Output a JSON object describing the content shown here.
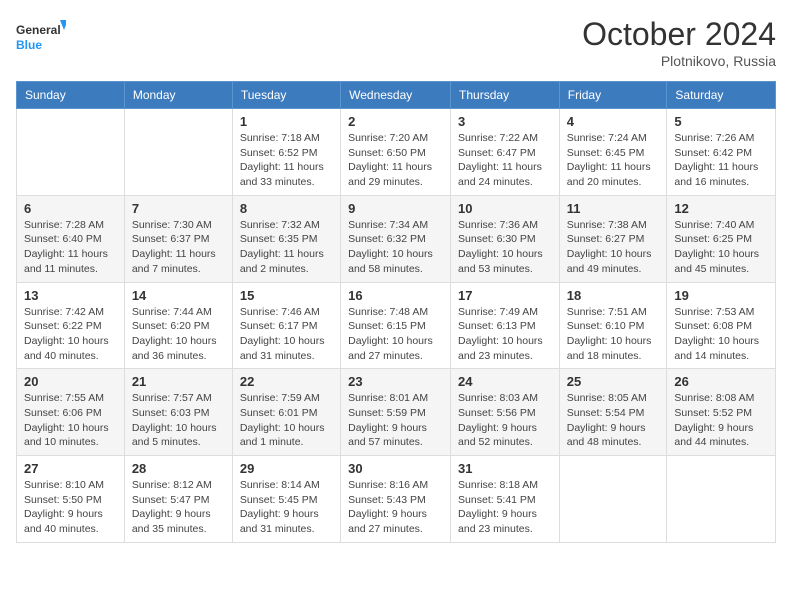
{
  "logo": {
    "general": "General",
    "blue": "Blue"
  },
  "header": {
    "month": "October 2024",
    "location": "Plotnikovo, Russia"
  },
  "weekdays": [
    "Sunday",
    "Monday",
    "Tuesday",
    "Wednesday",
    "Thursday",
    "Friday",
    "Saturday"
  ],
  "weeks": [
    [
      {
        "day": "",
        "info": ""
      },
      {
        "day": "",
        "info": ""
      },
      {
        "day": "1",
        "info": "Sunrise: 7:18 AM\nSunset: 6:52 PM\nDaylight: 11 hours\nand 33 minutes."
      },
      {
        "day": "2",
        "info": "Sunrise: 7:20 AM\nSunset: 6:50 PM\nDaylight: 11 hours\nand 29 minutes."
      },
      {
        "day": "3",
        "info": "Sunrise: 7:22 AM\nSunset: 6:47 PM\nDaylight: 11 hours\nand 24 minutes."
      },
      {
        "day": "4",
        "info": "Sunrise: 7:24 AM\nSunset: 6:45 PM\nDaylight: 11 hours\nand 20 minutes."
      },
      {
        "day": "5",
        "info": "Sunrise: 7:26 AM\nSunset: 6:42 PM\nDaylight: 11 hours\nand 16 minutes."
      }
    ],
    [
      {
        "day": "6",
        "info": "Sunrise: 7:28 AM\nSunset: 6:40 PM\nDaylight: 11 hours\nand 11 minutes."
      },
      {
        "day": "7",
        "info": "Sunrise: 7:30 AM\nSunset: 6:37 PM\nDaylight: 11 hours\nand 7 minutes."
      },
      {
        "day": "8",
        "info": "Sunrise: 7:32 AM\nSunset: 6:35 PM\nDaylight: 11 hours\nand 2 minutes."
      },
      {
        "day": "9",
        "info": "Sunrise: 7:34 AM\nSunset: 6:32 PM\nDaylight: 10 hours\nand 58 minutes."
      },
      {
        "day": "10",
        "info": "Sunrise: 7:36 AM\nSunset: 6:30 PM\nDaylight: 10 hours\nand 53 minutes."
      },
      {
        "day": "11",
        "info": "Sunrise: 7:38 AM\nSunset: 6:27 PM\nDaylight: 10 hours\nand 49 minutes."
      },
      {
        "day": "12",
        "info": "Sunrise: 7:40 AM\nSunset: 6:25 PM\nDaylight: 10 hours\nand 45 minutes."
      }
    ],
    [
      {
        "day": "13",
        "info": "Sunrise: 7:42 AM\nSunset: 6:22 PM\nDaylight: 10 hours\nand 40 minutes."
      },
      {
        "day": "14",
        "info": "Sunrise: 7:44 AM\nSunset: 6:20 PM\nDaylight: 10 hours\nand 36 minutes."
      },
      {
        "day": "15",
        "info": "Sunrise: 7:46 AM\nSunset: 6:17 PM\nDaylight: 10 hours\nand 31 minutes."
      },
      {
        "day": "16",
        "info": "Sunrise: 7:48 AM\nSunset: 6:15 PM\nDaylight: 10 hours\nand 27 minutes."
      },
      {
        "day": "17",
        "info": "Sunrise: 7:49 AM\nSunset: 6:13 PM\nDaylight: 10 hours\nand 23 minutes."
      },
      {
        "day": "18",
        "info": "Sunrise: 7:51 AM\nSunset: 6:10 PM\nDaylight: 10 hours\nand 18 minutes."
      },
      {
        "day": "19",
        "info": "Sunrise: 7:53 AM\nSunset: 6:08 PM\nDaylight: 10 hours\nand 14 minutes."
      }
    ],
    [
      {
        "day": "20",
        "info": "Sunrise: 7:55 AM\nSunset: 6:06 PM\nDaylight: 10 hours\nand 10 minutes."
      },
      {
        "day": "21",
        "info": "Sunrise: 7:57 AM\nSunset: 6:03 PM\nDaylight: 10 hours\nand 5 minutes."
      },
      {
        "day": "22",
        "info": "Sunrise: 7:59 AM\nSunset: 6:01 PM\nDaylight: 10 hours\nand 1 minute."
      },
      {
        "day": "23",
        "info": "Sunrise: 8:01 AM\nSunset: 5:59 PM\nDaylight: 9 hours\nand 57 minutes."
      },
      {
        "day": "24",
        "info": "Sunrise: 8:03 AM\nSunset: 5:56 PM\nDaylight: 9 hours\nand 52 minutes."
      },
      {
        "day": "25",
        "info": "Sunrise: 8:05 AM\nSunset: 5:54 PM\nDaylight: 9 hours\nand 48 minutes."
      },
      {
        "day": "26",
        "info": "Sunrise: 8:08 AM\nSunset: 5:52 PM\nDaylight: 9 hours\nand 44 minutes."
      }
    ],
    [
      {
        "day": "27",
        "info": "Sunrise: 8:10 AM\nSunset: 5:50 PM\nDaylight: 9 hours\nand 40 minutes."
      },
      {
        "day": "28",
        "info": "Sunrise: 8:12 AM\nSunset: 5:47 PM\nDaylight: 9 hours\nand 35 minutes."
      },
      {
        "day": "29",
        "info": "Sunrise: 8:14 AM\nSunset: 5:45 PM\nDaylight: 9 hours\nand 31 minutes."
      },
      {
        "day": "30",
        "info": "Sunrise: 8:16 AM\nSunset: 5:43 PM\nDaylight: 9 hours\nand 27 minutes."
      },
      {
        "day": "31",
        "info": "Sunrise: 8:18 AM\nSunset: 5:41 PM\nDaylight: 9 hours\nand 23 minutes."
      },
      {
        "day": "",
        "info": ""
      },
      {
        "day": "",
        "info": ""
      }
    ]
  ]
}
